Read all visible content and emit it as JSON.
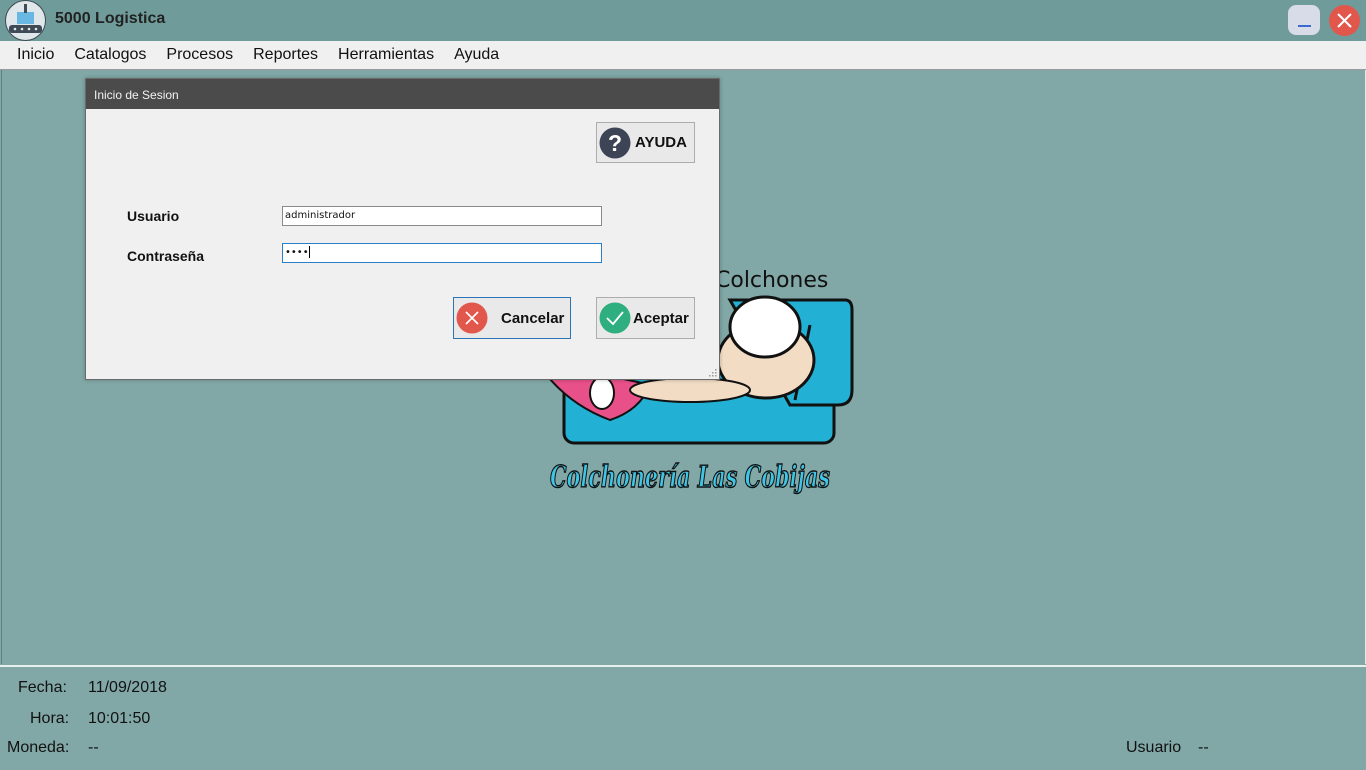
{
  "window": {
    "title": "5000 Logistica",
    "icon": "cart-logo-icon",
    "controls": {
      "minimize": "minimize-icon",
      "close": "close-icon"
    }
  },
  "menu": {
    "items": [
      "Inicio",
      "Catalogos",
      "Procesos",
      "Reportes",
      "Herramientas",
      "Ayuda"
    ]
  },
  "dialog": {
    "title": "Inicio de Sesion",
    "help_label": "AYUDA",
    "usuario_label": "Usuario",
    "usuario_value": "administrador",
    "contrasena_label": "Contraseña",
    "contrasena_value": "••••",
    "cancel_label": "Cancelar",
    "accept_label": "Aceptar"
  },
  "logo": {
    "top_text": "Colchones",
    "brand_text": "Colchonería Las Cobijas"
  },
  "status": {
    "fecha_label": "Fecha:",
    "fecha_value": "11/09/2018",
    "hora_label": "Hora:",
    "hora_value": "10:01:50",
    "moneda_label": "Moneda:",
    "moneda_value": "--",
    "usuario_label": "Usuario",
    "usuario_value": "--"
  },
  "colors": {
    "background": "#81a8a6",
    "titlebar": "#6f9c9a",
    "dialog_title": "#4b4b4b",
    "close_button": "#e2574c",
    "accept_icon": "#2fae7f",
    "cancel_icon": "#e2574c",
    "help_icon": "#3d4456",
    "logo_sofa": "#22b1d4"
  }
}
